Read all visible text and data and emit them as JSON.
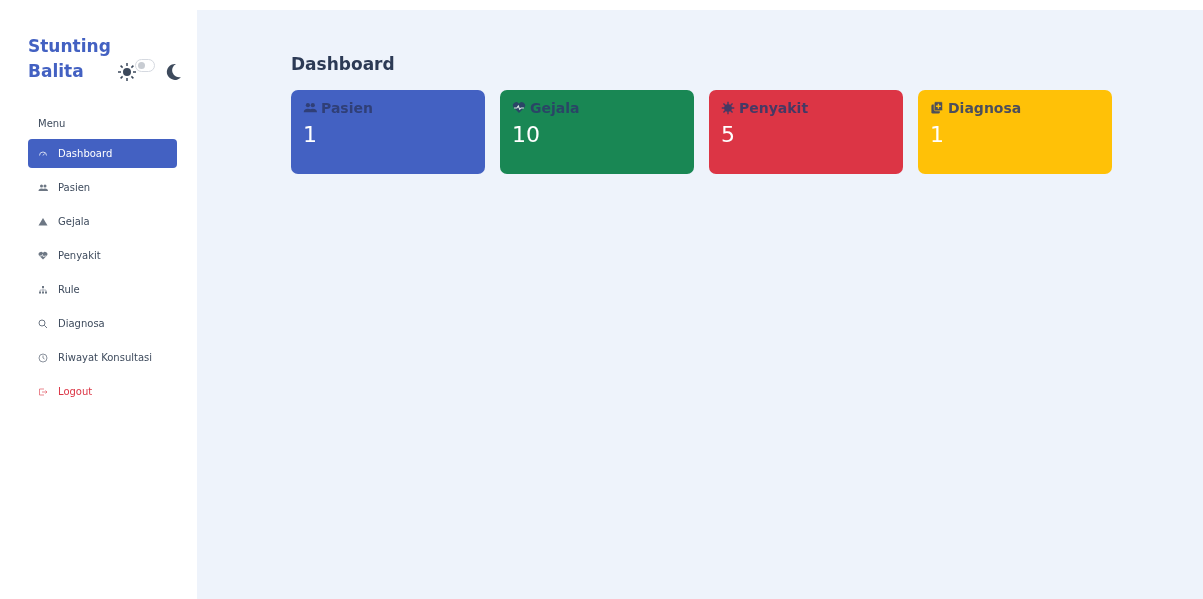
{
  "sidebar": {
    "brand": [
      "Stunting",
      "Balita"
    ],
    "theme_toggle": {
      "on": false
    },
    "menu_label": "Menu",
    "items": [
      {
        "label": "Dashboard",
        "kind": "gauge",
        "selected": true,
        "danger": false
      },
      {
        "label": "Pasien",
        "kind": "users",
        "selected": false,
        "danger": false
      },
      {
        "label": "Gejala",
        "kind": "warning",
        "selected": false,
        "danger": false
      },
      {
        "label": "Penyakit",
        "kind": "heart",
        "selected": false,
        "danger": false
      },
      {
        "label": "Rule",
        "kind": "tree",
        "selected": false,
        "danger": false
      },
      {
        "label": "Diagnosa",
        "kind": "search",
        "selected": false,
        "danger": false
      },
      {
        "label": "Riwayat Konsultasi",
        "kind": "clock",
        "selected": false,
        "danger": false
      },
      {
        "label": "Logout",
        "kind": "logout",
        "selected": false,
        "danger": true
      }
    ]
  },
  "main": {
    "title": "Dashboard",
    "cards": [
      {
        "label": "Pasien",
        "value": "1",
        "kind": "users",
        "color": "#4361c2"
      },
      {
        "label": "Gejala",
        "value": "10",
        "kind": "heart",
        "color": "#198754"
      },
      {
        "label": "Penyakit",
        "value": "5",
        "kind": "virus",
        "color": "#dc3545"
      },
      {
        "label": "Diagnosa",
        "value": "1",
        "kind": "copy",
        "color": "#ffc107"
      }
    ]
  }
}
